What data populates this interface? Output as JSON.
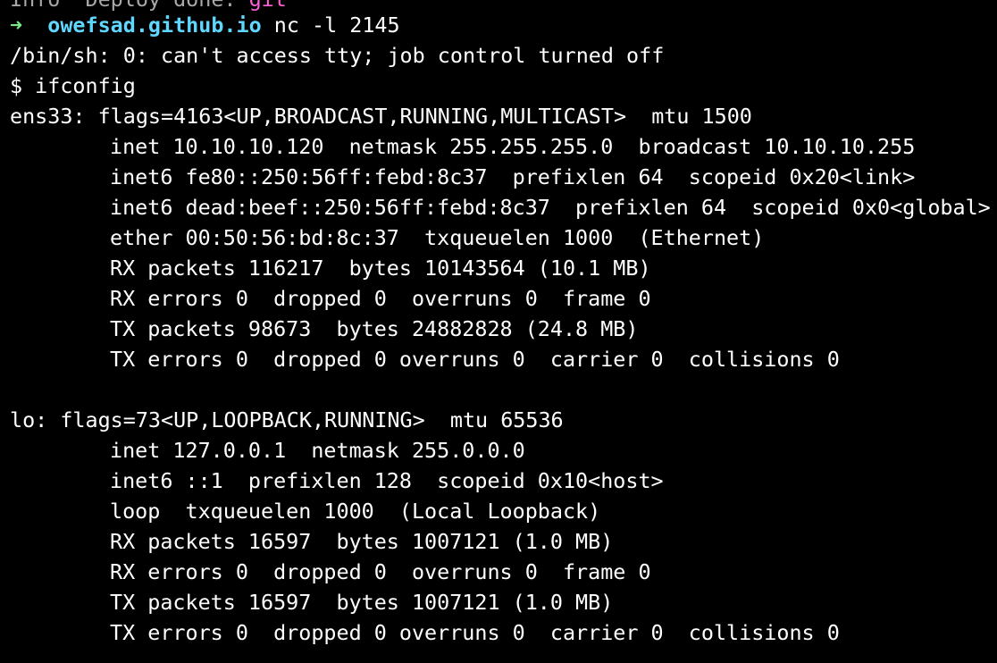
{
  "terminal": {
    "top_line": {
      "prefix": "Info  Deploy done: ",
      "accent": "git"
    },
    "prompt": {
      "arrow": "➜",
      "host": "owefsad.github.io",
      "command": "nc -l 2145"
    },
    "lines": [
      "/bin/sh: 0: can't access tty; job control turned off",
      "$ ifconfig",
      "ens33: flags=4163<UP,BROADCAST,RUNNING,MULTICAST>  mtu 1500"
    ],
    "ens33": [
      "inet 10.10.10.120  netmask 255.255.255.0  broadcast 10.10.10.255",
      "inet6 fe80::250:56ff:febd:8c37  prefixlen 64  scopeid 0x20<link>",
      "inet6 dead:beef::250:56ff:febd:8c37  prefixlen 64  scopeid 0x0<global>",
      "ether 00:50:56:bd:8c:37  txqueuelen 1000  (Ethernet)",
      "RX packets 116217  bytes 10143564 (10.1 MB)",
      "RX errors 0  dropped 0  overruns 0  frame 0",
      "TX packets 98673  bytes 24882828 (24.8 MB)",
      "TX errors 0  dropped 0 overruns 0  carrier 0  collisions 0"
    ],
    "lo_header": "lo: flags=73<UP,LOOPBACK,RUNNING>  mtu 65536",
    "lo": [
      "inet 127.0.0.1  netmask 255.0.0.0",
      "inet6 ::1  prefixlen 128  scopeid 0x10<host>",
      "loop  txqueuelen 1000  (Local Loopback)",
      "RX packets 16597  bytes 1007121 (1.0 MB)",
      "RX errors 0  dropped 0  overruns 0  frame 0",
      "TX packets 16597  bytes 1007121 (1.0 MB)",
      "TX errors 0  dropped 0 overruns 0  carrier 0  collisions 0"
    ],
    "colors": {
      "background": "#000000",
      "foreground": "#ffffff",
      "prompt_arrow": "#7ee787",
      "prompt_host": "#5fd7ff"
    }
  }
}
